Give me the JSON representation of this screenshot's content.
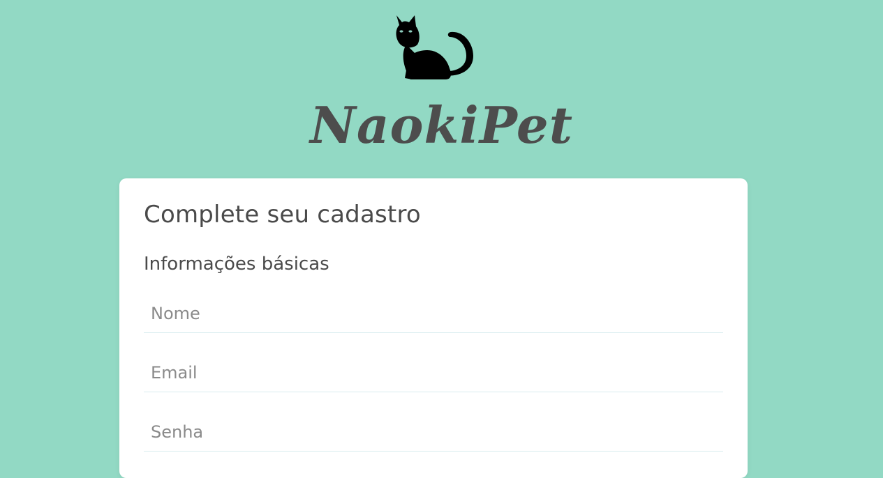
{
  "brand": {
    "name": "NaokiPet",
    "logo_icon": "black-cat-icon",
    "text_color": "#4d4d4d"
  },
  "page": {
    "background_color": "#92d9c4"
  },
  "form": {
    "title": "Complete seu cadastro",
    "section_title": "Informações básicas",
    "fields": {
      "nome": {
        "placeholder": "Nome",
        "value": ""
      },
      "email": {
        "placeholder": "Email",
        "value": ""
      },
      "senha": {
        "placeholder": "Senha",
        "value": ""
      }
    }
  }
}
